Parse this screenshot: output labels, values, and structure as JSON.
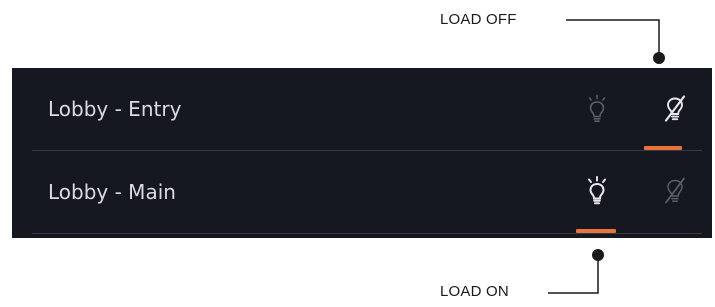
{
  "callouts": {
    "load_off": "LOAD OFF",
    "load_on": "LOAD ON"
  },
  "loads": [
    {
      "name": "Lobby - Entry",
      "state": "off"
    },
    {
      "name": "Lobby - Main",
      "state": "on"
    }
  ],
  "colors": {
    "panel_bg": "#151820",
    "text": "#d9dbe0",
    "icon_active": "#e6e8ec",
    "icon_dim": "#5a5f6a",
    "indicator": "#e8743b"
  },
  "icons": {
    "on": "light-bulb-icon",
    "off": "light-bulb-off-icon"
  }
}
